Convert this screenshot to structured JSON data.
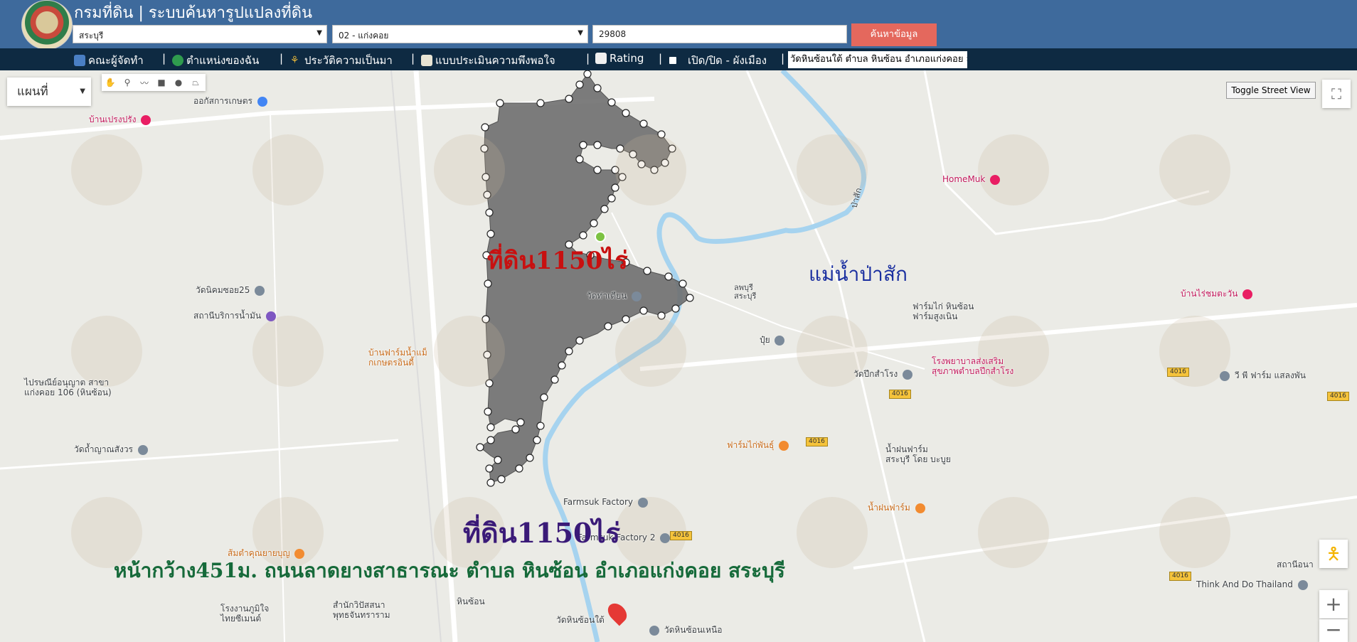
{
  "header": {
    "title": "กรมที่ดิน | ระบบค้นหารูปแปลงที่ดิน",
    "province": "สระบุรี",
    "district": "02 - แก่งคอย",
    "parcel_number": "29808",
    "search_label": "ค้นหาข้อมูล"
  },
  "navbar": {
    "items": [
      {
        "label": "คณะผู้จัดทำ",
        "icon": "building-icon"
      },
      {
        "label": "ตำแหน่งของฉัน",
        "icon": "globe-icon"
      },
      {
        "label": "ประวัติความเป็นมา",
        "icon": "plant-icon"
      },
      {
        "label": "แบบประเมินความพึงพอใจ",
        "icon": "form-icon"
      },
      {
        "label": "Rating",
        "icon": "chart-icon"
      },
      {
        "label": "เปิด/ปิด - ผังเมือง",
        "icon": "checkbox-icon"
      }
    ],
    "address": "วัดหินซ้อนใต้ ตำบล หินซ้อน อำเภอแก่งคอย ส"
  },
  "map": {
    "map_type": "แผนที่",
    "street_view_label": "Toggle Street View",
    "places": [
      {
        "name": "ออกัสการเกษตร",
        "style": "normal"
      },
      {
        "name": "บ้านเปรงปรัง",
        "style": "pink"
      },
      {
        "name": "วัดนิคมซอย25",
        "style": "normal"
      },
      {
        "name": "สถานีบริการน้ำมัน",
        "style": "normal"
      },
      {
        "name": "บ้านฟาร์มน้ำแม็\nกเกษตรอินดี้",
        "style": "orange"
      },
      {
        "name": "ไปรษณีย์อนุญาต สาขา\nแก่งคอย 106 (หินซ้อน)",
        "style": "normal"
      },
      {
        "name": "วัดถ้ำญาณสังวร",
        "style": "normal"
      },
      {
        "name": "วัดท่าเตียน",
        "style": "normal"
      },
      {
        "name": "HomeMuk",
        "style": "pink"
      },
      {
        "name": "ฟาร์มไก่ หินซ้อน\nฟาร์มสูงเนิน",
        "style": "normal"
      },
      {
        "name": "ปุ๋ย",
        "style": "normal"
      },
      {
        "name": "บ้านไร่ชมตะวัน",
        "style": "pink"
      },
      {
        "name": "โรงพยาบาลส่งเสริม\nสุขภาพตำบลปึกสำโรง",
        "style": "pink"
      },
      {
        "name": "วัดปึกสำโรง",
        "style": "normal"
      },
      {
        "name": "วี พี ฟาร์ม แสลงพัน",
        "style": "normal"
      },
      {
        "name": "ฟาร์มไก่พันธุ์",
        "style": "orange"
      },
      {
        "name": "น้ำฝนฟาร์ม\nสระบุรี โดย บะบูย",
        "style": "normal"
      },
      {
        "name": "น้ำฝนฟาร์ม",
        "style": "orange"
      },
      {
        "name": "Farmsuk Factory",
        "style": "normal"
      },
      {
        "name": "Farmsuk Factory 2",
        "style": "normal"
      },
      {
        "name": "ส้มตำคุณยายบุญ",
        "style": "orange"
      },
      {
        "name": "หินซ้อน",
        "style": "normal"
      },
      {
        "name": "โรงงานภูมิใจ\nไทยซีเมนต์",
        "style": "normal"
      },
      {
        "name": "สำนักวิปัสสนา\nพุทธจันทราราม",
        "style": "normal"
      },
      {
        "name": "วัดหินซ้อนใต้",
        "style": "normal"
      },
      {
        "name": "วัดหินซ้อนเหนือ",
        "style": "normal"
      },
      {
        "name": "Think And Do Thailand",
        "style": "normal"
      },
      {
        "name": "สถานีอนา",
        "style": "normal"
      },
      {
        "name": "ป่าสัก",
        "style": "normal"
      },
      {
        "name": "ลพบุรี\nสระบุรี",
        "style": "normal"
      }
    ],
    "route_number": "4016",
    "annotations": {
      "land_red": "ที่ดิน1150ไร่",
      "river": "แม่น้ำป่าสัก",
      "land_purple": "ที่ดิน1150ไร่",
      "frontage": "หน้ากว้าง451ม. ถนนลาดยางสาธารณะ ตำบล หินซ้อน อำเภอแก่งคอย สระบุรี"
    }
  }
}
